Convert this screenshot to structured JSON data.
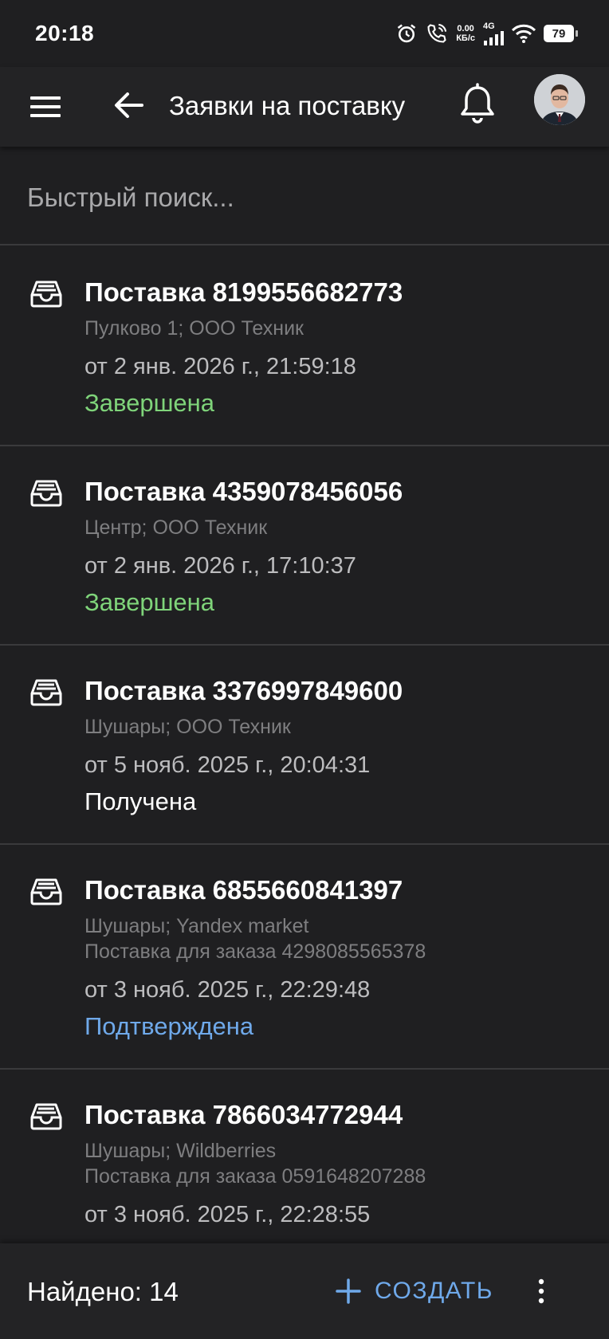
{
  "status_bar": {
    "time": "20:18",
    "net_speed": "0.00",
    "net_unit": "КБ/с",
    "net_type": "4G",
    "battery": "79"
  },
  "header": {
    "title": "Заявки на поставку",
    "icons": [
      "menu-icon",
      "arrow-left-icon",
      "bell-icon",
      "avatar"
    ]
  },
  "search": {
    "placeholder": "Быстрый поиск..."
  },
  "items": [
    {
      "title": "Поставка 8199556682773",
      "sub1": "Пулково 1; ООО Техник",
      "sub2": "",
      "date": "от 2 янв. 2026 г., 21:59:18",
      "status": "Завершена",
      "status_color": "#7fd47a"
    },
    {
      "title": "Поставка 4359078456056",
      "sub1": "Центр; ООО Техник",
      "sub2": "",
      "date": "от 2 янв. 2026 г., 17:10:37",
      "status": "Завершена",
      "status_color": "#7fd47a"
    },
    {
      "title": "Поставка 3376997849600",
      "sub1": "Шушары; ООО Техник",
      "sub2": "",
      "date": "от 5 нояб. 2025 г., 20:04:31",
      "status": "Получена",
      "status_color": "#ffffff"
    },
    {
      "title": "Поставка 6855660841397",
      "sub1": "Шушары; Yandex market",
      "sub2": "Поставка для заказа 4298085565378",
      "date": "от 3 нояб. 2025 г., 22:29:48",
      "status": "Подтверждена",
      "status_color": "#6fa9ea"
    },
    {
      "title": "Поставка 7866034772944",
      "sub1": "Шушары; Wildberries",
      "sub2": "Поставка для заказа 0591648207288",
      "date": "от 3 нояб. 2025 г., 22:28:55",
      "status": "",
      "status_color": ""
    }
  ],
  "footer": {
    "found_label": "Найдено: 14",
    "create_label": "СОЗДАТЬ",
    "accent": "#6fa9ea"
  }
}
